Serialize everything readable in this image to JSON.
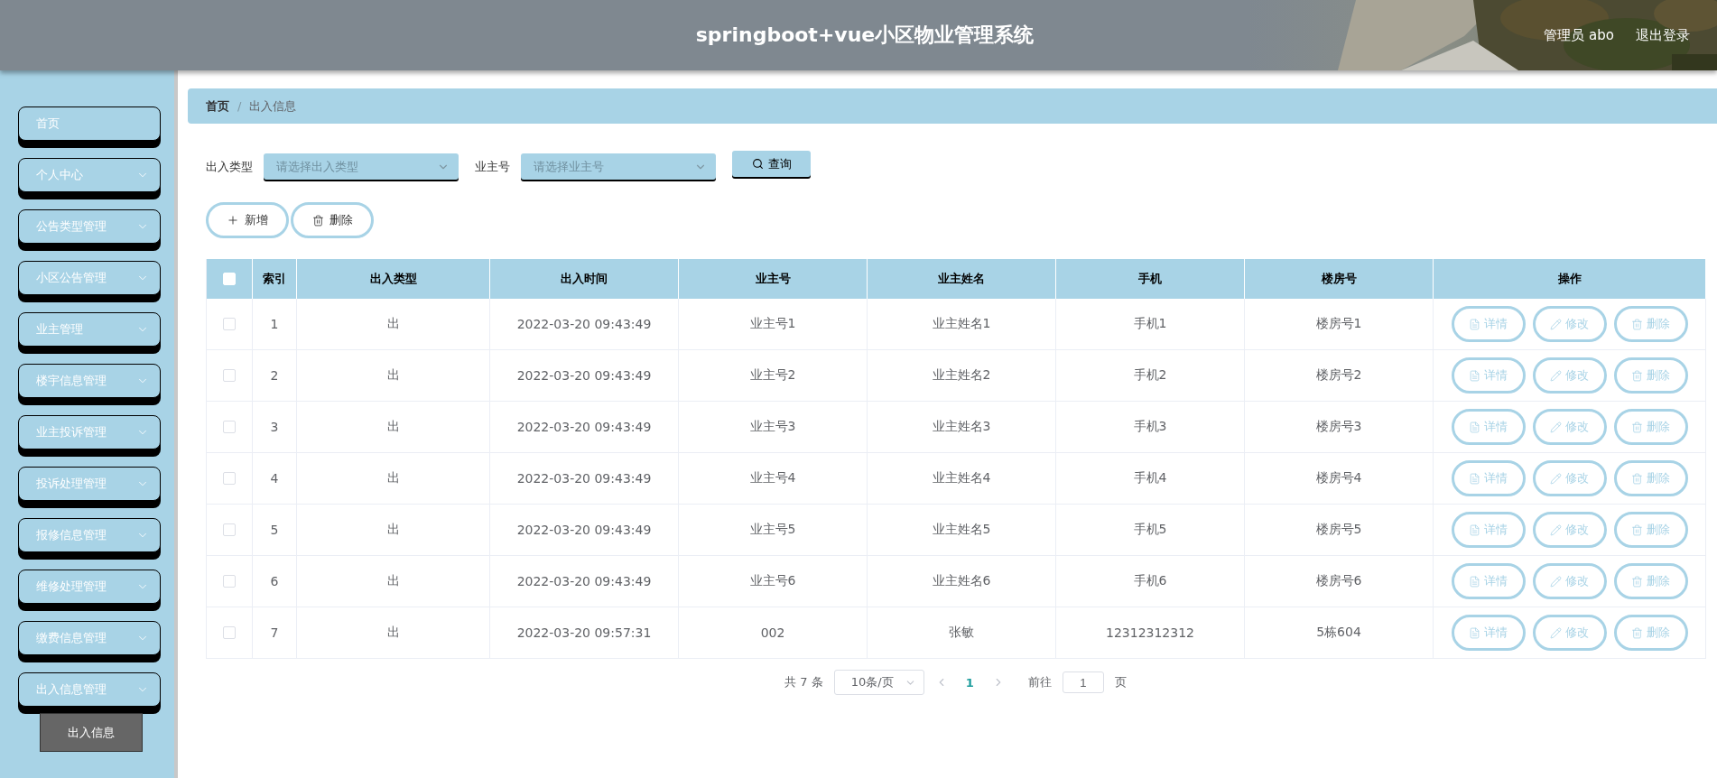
{
  "header": {
    "title": "springboot+vue小区物业管理系统",
    "user": "管理员 abo",
    "logout": "退出登录"
  },
  "sidebar": {
    "items": [
      {
        "label": "首页",
        "kind": "link"
      },
      {
        "label": "个人中心",
        "kind": "submenu"
      },
      {
        "label": "公告类型管理",
        "kind": "submenu"
      },
      {
        "label": "小区公告管理",
        "kind": "submenu"
      },
      {
        "label": "业主管理",
        "kind": "submenu"
      },
      {
        "label": "楼宇信息管理",
        "kind": "submenu"
      },
      {
        "label": "业主投诉管理",
        "kind": "submenu"
      },
      {
        "label": "投诉处理管理",
        "kind": "submenu"
      },
      {
        "label": "报修信息管理",
        "kind": "submenu"
      },
      {
        "label": "维修处理管理",
        "kind": "submenu"
      },
      {
        "label": "缴费信息管理",
        "kind": "submenu"
      },
      {
        "label": "出入信息管理",
        "kind": "submenu",
        "children": [
          {
            "label": "出入信息",
            "selected": true
          }
        ]
      }
    ]
  },
  "breadcrumb": {
    "items": [
      "首页",
      "出入信息"
    ],
    "separator": "/"
  },
  "search": {
    "fields": [
      {
        "label": "出入类型",
        "placeholder": "请选择出入类型"
      },
      {
        "label": "业主号",
        "placeholder": "请选择业主号"
      }
    ],
    "button": "查询"
  },
  "actions": [
    "新增",
    "删除"
  ],
  "table": {
    "select_all": {
      "checked": false
    },
    "columns": [
      "索引",
      "出入类型",
      "出入时间",
      "业主号",
      "业主姓名",
      "手机",
      "楼房号",
      "操作"
    ],
    "rows": [
      {
        "checked": false,
        "cells": [
          "1",
          "出",
          "2022-03-20 09:43:49",
          "业主号1",
          "业主姓名1",
          "手机1",
          "楼房号1"
        ],
        "actions": [
          "详情",
          "修改",
          "删除"
        ]
      },
      {
        "checked": false,
        "cells": [
          "2",
          "出",
          "2022-03-20 09:43:49",
          "业主号2",
          "业主姓名2",
          "手机2",
          "楼房号2"
        ],
        "actions": [
          "详情",
          "修改",
          "删除"
        ]
      },
      {
        "checked": false,
        "cells": [
          "3",
          "出",
          "2022-03-20 09:43:49",
          "业主号3",
          "业主姓名3",
          "手机3",
          "楼房号3"
        ],
        "actions": [
          "详情",
          "修改",
          "删除"
        ]
      },
      {
        "checked": false,
        "cells": [
          "4",
          "出",
          "2022-03-20 09:43:49",
          "业主号4",
          "业主姓名4",
          "手机4",
          "楼房号4"
        ],
        "actions": [
          "详情",
          "修改",
          "删除"
        ]
      },
      {
        "checked": false,
        "cells": [
          "5",
          "出",
          "2022-03-20 09:43:49",
          "业主号5",
          "业主姓名5",
          "手机5",
          "楼房号5"
        ],
        "actions": [
          "详情",
          "修改",
          "删除"
        ]
      },
      {
        "checked": false,
        "cells": [
          "6",
          "出",
          "2022-03-20 09:43:49",
          "业主号6",
          "业主姓名6",
          "手机6",
          "楼房号6"
        ],
        "actions": [
          "详情",
          "修改",
          "删除"
        ]
      },
      {
        "checked": false,
        "cells": [
          "7",
          "出",
          "2022-03-20 09:57:31",
          "002",
          "张敏",
          "12312312312",
          "5栋604"
        ],
        "actions": [
          "详情",
          "修改",
          "删除"
        ]
      }
    ]
  },
  "pagination": {
    "total": "共 7 条",
    "page_size": "10条/页",
    "pages": [
      {
        "label": "1",
        "selected": true
      }
    ],
    "goto_label": "前往",
    "goto_value": "1",
    "goto_suffix": "页"
  }
}
